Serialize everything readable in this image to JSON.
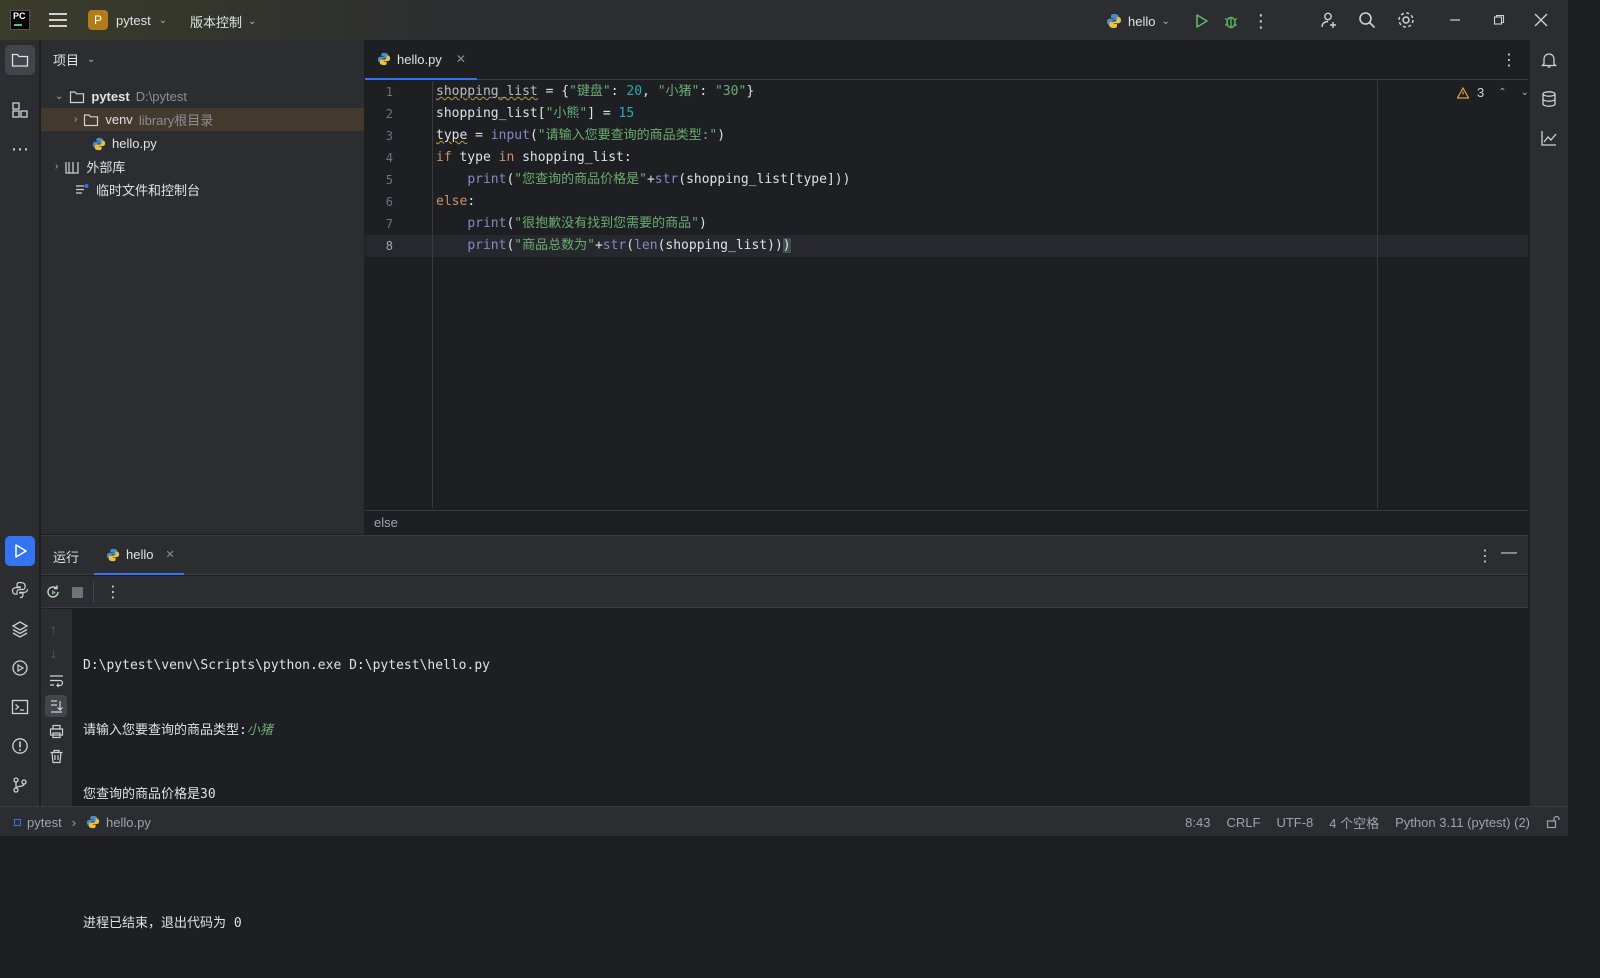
{
  "titlebar": {
    "project_initial": "P",
    "project_name": "pytest",
    "vcs_label": "版本控制",
    "run_config": "hello"
  },
  "left_strip": {
    "icons": [
      "folder-icon",
      "structure-icon",
      "more-icon",
      "run-icon",
      "python-console-icon",
      "layers-icon",
      "services-icon",
      "terminal-icon",
      "problems-icon",
      "git-icon"
    ]
  },
  "project_panel": {
    "title": "项目",
    "root_name": "pytest",
    "root_path": "D:\\pytest",
    "venv_name": "venv",
    "venv_hint": "library根目录",
    "file_name": "hello.py",
    "external_libs": "外部库",
    "scratches": "临时文件和控制台"
  },
  "editor": {
    "tab_label": "hello.py",
    "warning_count": "3",
    "breadcrumb": "else",
    "line_numbers": [
      "1",
      "2",
      "3",
      "4",
      "5",
      "6",
      "7",
      "8"
    ]
  },
  "run_panel": {
    "tab_run": "运行",
    "tab_hello": "hello",
    "output": {
      "line1": "D:\\pytest\\venv\\Scripts\\python.exe D:\\pytest\\hello.py",
      "line2_prompt": "请输入您要查询的商品类型:",
      "line2_input": "小猪",
      "line3": "您查询的商品价格是30",
      "line5": "进程已结束，退出代码为 0"
    }
  },
  "statusbar": {
    "crumb_project": "pytest",
    "crumb_file": "hello.py",
    "position": "8:43",
    "line_sep": "CRLF",
    "encoding": "UTF-8",
    "indent": "4 个空格",
    "interpreter": "Python 3.11 (pytest) (2)"
  },
  "colors": {
    "accent": "#3574f0",
    "keyword": "#cf8e6d",
    "string": "#6aab73",
    "number": "#2aacb8"
  }
}
